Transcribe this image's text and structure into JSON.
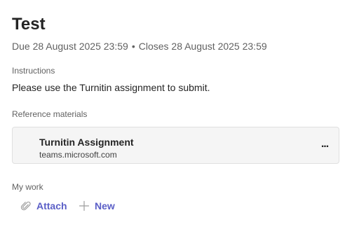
{
  "assignment": {
    "title": "Test",
    "due_text": "Due 28 August 2025 23:59",
    "separator": "•",
    "closes_text": "Closes 28 August 2025 23:59"
  },
  "instructions": {
    "label": "Instructions",
    "text": "Please use the Turnitin assignment to submit."
  },
  "reference_materials": {
    "label": "Reference materials",
    "items": [
      {
        "title": "Turnitin Assignment",
        "url": "teams.microsoft.com",
        "more_label": "..."
      }
    ]
  },
  "my_work": {
    "label": "My work",
    "actions": {
      "attach_label": "Attach",
      "attach_icon": "paperclip-icon",
      "new_label": "New",
      "new_icon": "plus-icon"
    }
  },
  "colors": {
    "accent": "#5b5fc7",
    "muted_text": "#616161",
    "card_background": "#f5f5f5"
  }
}
